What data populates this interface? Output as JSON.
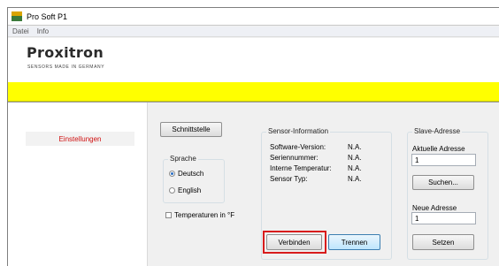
{
  "window": {
    "title": "Pro Soft P1"
  },
  "menu": [
    "Datei",
    "Info"
  ],
  "logo": {
    "name": "Proxitron",
    "tagline": "SENSORS MADE IN GERMANY"
  },
  "colors": {
    "banner": "#ffff00",
    "nav_active_text": "#d01010",
    "highlight_outline": "#d81c1c"
  },
  "nav": {
    "einstellungen": "Einstellungen"
  },
  "settings": {
    "schnittstelle_label": "Schnittstelle",
    "sprache": {
      "title": "Sprache",
      "options": [
        "Deutsch",
        "English"
      ],
      "selected": "Deutsch"
    },
    "temperature_checkbox_label": "Temperaturen in °F",
    "temperature_checkbox_checked": false
  },
  "sensor_info": {
    "title": "Sensor-Information",
    "rows": [
      {
        "label": "Software-Version:",
        "value": "N.A."
      },
      {
        "label": "Seriennummer:",
        "value": "N.A."
      },
      {
        "label": "Interne Temperatur:",
        "value": "N.A."
      },
      {
        "label": "Sensor Typ:",
        "value": "N.A."
      }
    ],
    "connect_label": "Verbinden",
    "disconnect_label": "Trennen"
  },
  "slave": {
    "title": "Slave-Adresse",
    "current_label": "Aktuelle Adresse",
    "current_value": "1",
    "search_label": "Suchen...",
    "new_label": "Neue Adresse",
    "new_value": "1",
    "set_label": "Setzen"
  }
}
